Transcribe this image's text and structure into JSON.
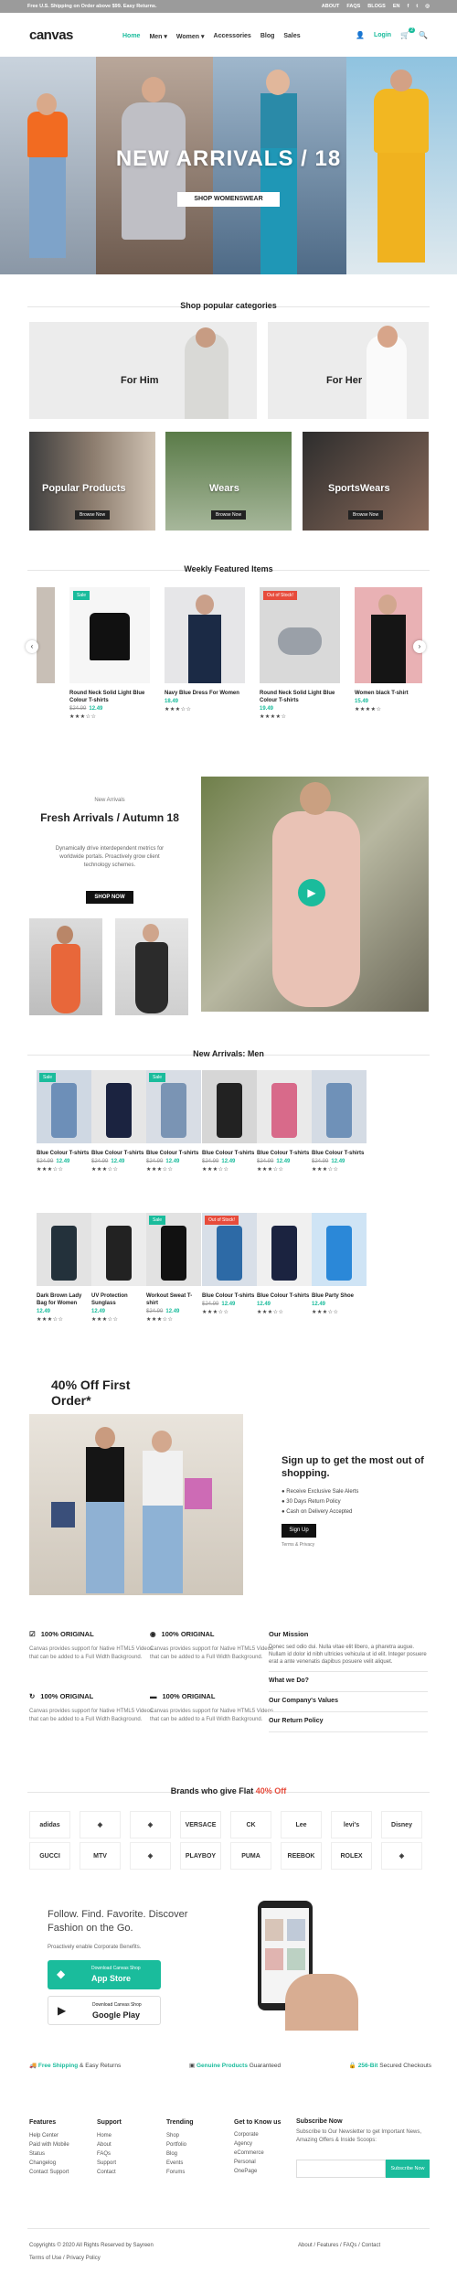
{
  "topbar": {
    "shipping": "Free U.S. Shipping on Order above $99. Easy Returns.",
    "links": [
      "ABOUT",
      "FAQS",
      "BLOGS",
      "EN"
    ]
  },
  "header": {
    "logo": "canvas",
    "nav": [
      "Home",
      "Men",
      "Women",
      "Accessories",
      "Blog",
      "Sales"
    ],
    "login": "Login",
    "cart_count": "2"
  },
  "hero": {
    "title": "NEW ARRIVALS / 18",
    "button": "SHOP WOMENSWEAR"
  },
  "categories": {
    "title": "Shop popular categories",
    "for_him": "For Him",
    "for_her": "For Her",
    "popular": "Popular Products",
    "wears": "Wears",
    "sportswears": "SportsWears",
    "browse": "Browse Now"
  },
  "weekly": {
    "title": "Weekly Featured Items",
    "items": [
      {
        "name": "",
        "old": "",
        "price": "",
        "stars": "",
        "badge": ""
      },
      {
        "name": "Round Neck Solid Light Blue Colour T-shirts",
        "old": "$24.99",
        "price": "12.49",
        "stars": "★★★☆☆",
        "badge": "Sale"
      },
      {
        "name": "Navy Blue Dress For Women",
        "old": "",
        "price": "18.49",
        "stars": "★★★☆☆",
        "badge": ""
      },
      {
        "name": "Round Neck Solid Light Blue Colour T-shirts",
        "old": "",
        "price": "19.49",
        "stars": "★★★★☆",
        "badge": "Out of Stock!"
      },
      {
        "name": "Women black T-shirt",
        "old": "",
        "price": "15.49",
        "stars": "★★★★☆",
        "badge": ""
      }
    ]
  },
  "promo": {
    "kicker": "New Arrivals",
    "title": "Fresh Arrivals / Autumn 18",
    "desc": "Dynamically drive interdependent metrics for worldwide portals. Proactively grow client technology schemes.",
    "button": "SHOP NOW"
  },
  "men": {
    "title": "New Arrivals: Men",
    "items": [
      {
        "name": "Blue Colour T-shirts",
        "old": "$24.99",
        "price": "12.49",
        "stars": "★★★☆☆",
        "badge": "Sale"
      },
      {
        "name": "Blue Colour T-shirts",
        "old": "$24.99",
        "price": "12.49",
        "stars": "★★★☆☆",
        "badge": ""
      },
      {
        "name": "Blue Colour T-shirts",
        "old": "$24.99",
        "price": "12.49",
        "stars": "★★★☆☆",
        "badge": "Sale"
      },
      {
        "name": "Blue Colour T-shirts",
        "old": "$24.99",
        "price": "12.49",
        "stars": "★★★☆☆",
        "badge": ""
      },
      {
        "name": "Blue Colour T-shirts",
        "old": "$24.99",
        "price": "12.49",
        "stars": "★★★☆☆",
        "badge": ""
      },
      {
        "name": "Blue Colour T-shirts",
        "old": "$24.99",
        "price": "12.49",
        "stars": "★★★☆☆",
        "badge": ""
      },
      {
        "name": "Dark Brown Lady Bag for Women",
        "old": "",
        "price": "12.49",
        "stars": "★★★☆☆",
        "badge": ""
      },
      {
        "name": "UV Protection Sunglass",
        "old": "",
        "price": "12.49",
        "stars": "★★★☆☆",
        "badge": ""
      },
      {
        "name": "Workout Sweat T-shirt",
        "old": "$24.99",
        "price": "12.49",
        "stars": "★★★☆☆",
        "badge": "Sale"
      },
      {
        "name": "Blue Colour T-shirts",
        "old": "$24.99",
        "price": "12.49",
        "stars": "★★★☆☆",
        "badge": "Out of Stock!"
      },
      {
        "name": "Blue Colour T-shirts",
        "old": "",
        "price": "12.49",
        "stars": "★★★☆☆",
        "badge": ""
      },
      {
        "name": "Blue Party Shoe",
        "old": "",
        "price": "12.49",
        "stars": "★★★☆☆",
        "badge": ""
      }
    ]
  },
  "offer": {
    "title": "40% Off First Order*",
    "signup_title": "Sign up to get the most out of shopping.",
    "benefits": [
      "Receive Exclusive Sale Alerts",
      "30 Days Return Policy",
      "Cash on Delivery Accepted"
    ],
    "button": "Sign Up",
    "terms": "Terms & Privacy"
  },
  "features": [
    {
      "t": "100% ORIGINAL",
      "d": "Canvas provides support for Native HTML5 Videos that can be added to a Full Width Background."
    },
    {
      "t": "100% ORIGINAL",
      "d": "Canvas provides support for Native HTML5 Videos that can be added to a Full Width Background."
    },
    {
      "t": "100% ORIGINAL",
      "d": "Canvas provides support for Native HTML5 Videos that can be added to a Full Width Background."
    },
    {
      "t": "100% ORIGINAL",
      "d": "Canvas provides support for Native HTML5 Videos that can be added to a Full Width Background."
    }
  ],
  "mission": {
    "title": "Our Mission",
    "text": "Donec sed odio dui. Nulla vitae elit libero, a pharetra augue. Nullam id dolor id nibh ultricies vehicula ut id elit. Integer posuere erat a ante venenatis dapibus posuere velit aliquet.",
    "links": [
      "What we Do?",
      "Our Company's Values",
      "Our Return Policy"
    ]
  },
  "brands": {
    "title_a": "Brands who give Flat ",
    "title_b": "40% Off",
    "names": [
      "adidas",
      "",
      "",
      "VERSACE",
      "CK",
      "Lee",
      "levi's",
      "Disney",
      "GUCCI",
      "MTV",
      "",
      "PLAYBOY",
      "PUMA",
      "REEBOK",
      "ROLEX",
      ""
    ]
  },
  "app": {
    "title": "Follow. Find. Favorite. Discover Fashion on the Go.",
    "desc": "Proactively enable Corporate Benefits.",
    "store1_small": "Download Canvas Shop",
    "store1": "App Store",
    "store2_small": "Download Canvas Shop",
    "store2": "Google Play"
  },
  "usp": [
    {
      "b": "Free Shipping",
      "r": " & Easy Returns"
    },
    {
      "b": "Genuine Products",
      "r": " Guaranteed"
    },
    {
      "b": "256-Bit",
      "r": " Secured Checkouts"
    }
  ],
  "footer": {
    "cols": [
      {
        "h": "Features",
        "items": [
          "Help Center",
          "Paid with Mobile",
          "Status",
          "Changelog",
          "Contact Support"
        ]
      },
      {
        "h": "Support",
        "items": [
          "Home",
          "About",
          "FAQs",
          "Support",
          "Contact"
        ]
      },
      {
        "h": "Trending",
        "items": [
          "Shop",
          "Portfolio",
          "Blog",
          "Events",
          "Forums"
        ]
      },
      {
        "h": "Get to Know us",
        "items": [
          "Corporate",
          "Agency",
          "eCommerce",
          "Personal",
          "OnePage"
        ]
      }
    ],
    "subscribe_title": "Subscribe Now",
    "subscribe_text": "Subscribe to Our Newsletter to get Important News, Amazing Offers & Inside Scoops:",
    "subscribe_btn": "Subscribe Now",
    "copyright": "Copyrights © 2020 All Rights Reserved by Sayreen",
    "terms": "Terms of Use",
    "privacy": "Privacy Policy",
    "links": [
      "About",
      "Features",
      "FAQs",
      "Contact"
    ]
  }
}
